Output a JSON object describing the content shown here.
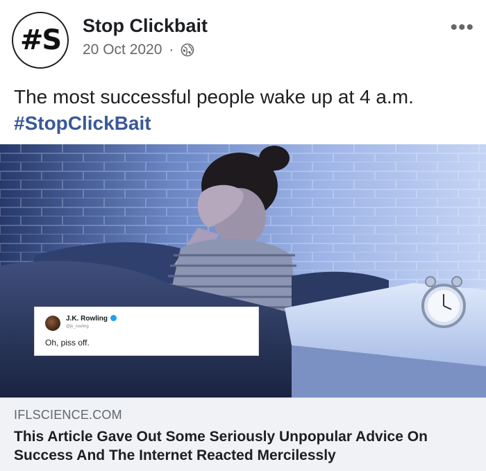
{
  "post": {
    "avatar_text": "#S",
    "author": "Stop Clickbait",
    "date": "20 Oct 2020",
    "separator": "·",
    "privacy_icon": "globe-icon",
    "more_label": "•••",
    "text": "The most successful people wake up at 4 a.m.",
    "hashtag": "#StopClickBait"
  },
  "media": {
    "tweet": {
      "name": "J.K. Rowling",
      "handle": "@jk_rowling",
      "text": "Oh, piss off.",
      "verified_icon": "verified-badge-icon"
    }
  },
  "link_preview": {
    "domain": "IFLSCIENCE.COM",
    "title": "This Article Gave Out Some Seriously Unpopular Advice On Success And The Internet Reacted Mercilessly"
  },
  "colors": {
    "hashtag": "#385898",
    "meta_text": "#65676b",
    "link_box_bg": "#f0f2f5",
    "verified": "#1da1f2"
  }
}
